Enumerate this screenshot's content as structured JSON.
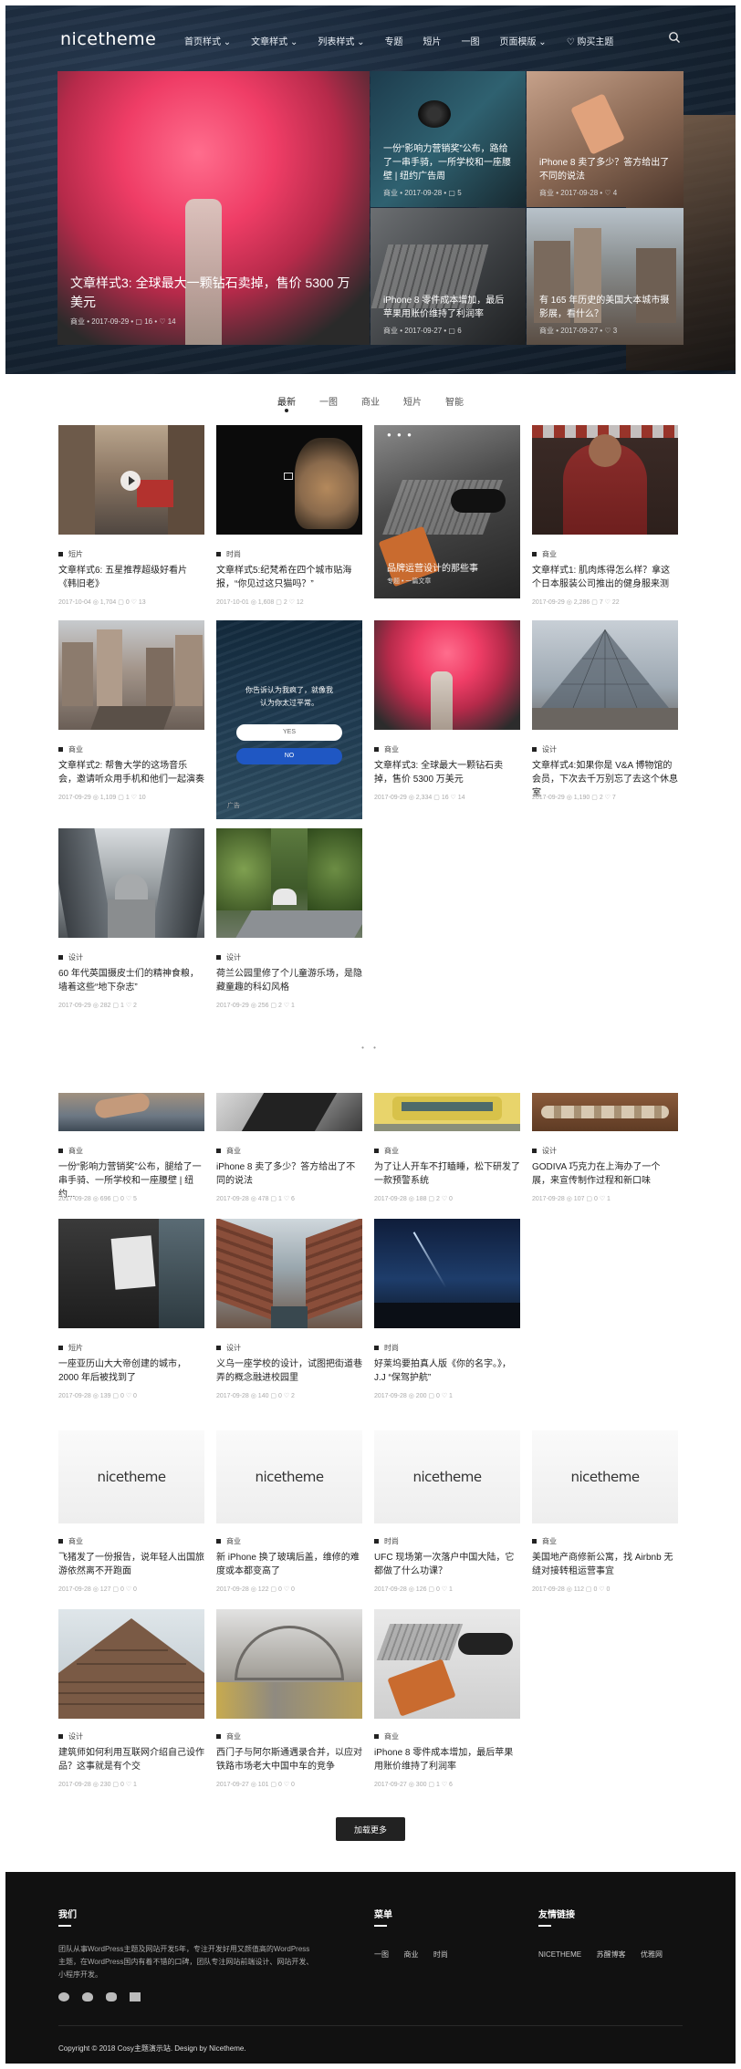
{
  "header": {
    "logo": "nicetheme",
    "menu": [
      "首页样式 ⌄",
      "文章样式 ⌄",
      "列表样式 ⌄",
      "专题",
      "短片",
      "一图",
      "页面模版 ⌄",
      "♡ 购买主题"
    ]
  },
  "featured": {
    "big": {
      "title": "文章样式3: 全球最大一颗钻石卖掉，售价 5300 万美元",
      "meta": "商业 • 2017-09-29 • ▢ 16 • ♡ 14"
    },
    "small": [
      {
        "title": "一份“影响力营销奖”公布，路给了一串手骑，一所学校和一座腰壁 | 纽约广告周",
        "meta": "商业 • 2017-09-28 • ▢ 5"
      },
      {
        "title": "iPhone 8 卖了多少？答方给出了不同的说法",
        "meta": "商业 • 2017-09-28 • ♡ 4"
      },
      {
        "title": "iPhone 8 零件成本增加，最后苹果用账价维持了利润率",
        "meta": "商业 • 2017-09-27 • ▢ 6"
      },
      {
        "title": "有 165 年历史的美国大本城市摄影展，看什么？",
        "meta": "商业 • 2017-09-27 • ♡ 3"
      }
    ]
  },
  "tabs": [
    "最新",
    "一图",
    "商业",
    "短片",
    "智能"
  ],
  "grid1": [
    {
      "cat": "短片",
      "title": "文章样式6: 五星推荐超级好看片《韩旧老》",
      "meta": "2017-10-04  ◎ 1,704  ▢ 0  ♡ 13"
    },
    {
      "cat": "时尚",
      "title": "文章样式5:纪梵希在四个城市贴海报，“你见过这只猫吗？”",
      "meta": "2017-10-01  ◎ 1,608  ▢ 2  ♡ 12"
    },
    {
      "cat": "专题",
      "title": "品牌运营设计的那些事",
      "meta": "专题 • 一篇文章"
    },
    {
      "cat": "商业",
      "title": "文章样式1: 肌肉炼得怎么样？拿这个日本服装公司推出的健身服来测",
      "meta": "2017-09-29  ◎ 2,286  ▢ 7  ♡ 22"
    },
    {
      "cat": "商业",
      "title": "文章样式2: 帮鲁大学的这场音乐会，邀请听众用手机和他们一起演奏",
      "meta": "2017-09-29  ◎ 1,109  ▢ 1  ♡ 10"
    },
    {
      "cat": "广告",
      "title": "你告诉认为我疯了，就像我认为你太过平常。",
      "yes": "YES",
      "no": "NO"
    },
    {
      "cat": "商业",
      "title": "文章样式3: 全球最大一颗钻石卖掉，售价 5300 万美元",
      "meta": "2017-09-29  ◎ 2,334  ▢ 16  ♡ 14"
    },
    {
      "cat": "设计",
      "title": "文章样式4:如果你是 V&A 博物馆的会员，下次去千万别忘了去这个休息室",
      "meta": "2017-09-29  ◎ 1,190  ▢ 2  ♡ 7"
    },
    {
      "cat": "设计",
      "title": "60 年代英国摄皮士们的精神食粮，墙着这些“地下杂志”",
      "meta": "2017-09-29  ◎ 282  ▢ 1  ♡ 2"
    },
    {
      "cat": "设计",
      "title": "荷兰公园里修了个儿童游乐场，是隐藏童趣的科幻风格",
      "meta": "2017-09-29  ◎ 256  ▢ 2  ♡ 1"
    }
  ],
  "grid2": [
    {
      "cat": "商业",
      "title": "一份“影响力营销奖”公布，腿给了一串手骑、一所学校和一座腰壁 | 纽约...",
      "meta": "2017-09-28  ◎ 696  ▢ 0  ♡ 5"
    },
    {
      "cat": "商业",
      "title": "iPhone 8 卖了多少？答方给出了不同的说法",
      "meta": "2017-09-28  ◎ 478  ▢ 1  ♡ 6"
    },
    {
      "cat": "商业",
      "title": "为了让人开车不打瞌睡，松下研发了一款预警系统",
      "meta": "2017-09-28  ◎ 188  ▢ 2  ♡ 0"
    },
    {
      "cat": "设计",
      "title": "GODIVA 巧克力在上海办了一个展，来宣传制作过程和新口味",
      "meta": "2017-09-28  ◎ 107  ▢ 0  ♡ 1"
    },
    {
      "cat": "短片",
      "title": "一座亚历山大大帝创建的城市，2000 年后被找到了",
      "meta": "2017-09-28  ◎ 139  ▢ 0  ♡ 0"
    },
    {
      "cat": "设计",
      "title": "义乌一座学校的设计，试图把街道巷弄的概念融进校园里",
      "meta": "2017-09-28  ◎ 140  ▢ 0  ♡ 2"
    },
    {
      "cat": "时尚",
      "title": "好莱坞要拍真人版《你的名字。》，J.J “保驾护航”",
      "meta": "2017-09-28  ◎ 200  ▢ 0  ♡ 1"
    },
    {
      "cat": "商业",
      "title": "飞猪发了一份报告，说年轻人出国旅游依然离不开跑面",
      "meta": "2017-09-28  ◎ 127  ▢ 0  ♡ 0"
    },
    {
      "cat": "商业",
      "title": "新 iPhone 换了玻璃后盖，维修的难度或本都变高了",
      "meta": "2017-09-28  ◎ 122  ▢ 0  ♡ 0"
    },
    {
      "cat": "时尚",
      "title": "UFC 现场第一次落户中国大陆，它都做了什么功课？",
      "meta": "2017-09-28  ◎ 126  ▢ 0  ♡ 1"
    },
    {
      "cat": "商业",
      "title": "美国地产商修新公寓，找 Airbnb 无缝对接转租运营事宜",
      "meta": "2017-09-28  ◎ 112  ▢ 0  ♡ 0"
    },
    {
      "cat": "设计",
      "title": "建筑师如何利用互联网介绍自己设作品？这事就是有个交",
      "meta": "2017-09-28  ◎ 230  ▢ 0  ♡ 1"
    },
    {
      "cat": "商业",
      "title": "西门子与阿尔斯通遇录合并，以应对铁路市场老大中国中车的竞争",
      "meta": "2017-09-27  ◎ 101  ▢ 0  ♡ 0"
    },
    {
      "cat": "商业",
      "title": "iPhone 8 零件成本增加，最后苹果用账价维持了利润率",
      "meta": "2017-09-27  ◎ 300  ▢ 1  ♡ 6"
    }
  ],
  "placeholder_logo": "nicetheme",
  "load_more": "加载更多",
  "footer": {
    "about_heading": "我们",
    "about_text": "团队从事WordPress主题及网站开发5年，专注开发好用又颜值高的WordPress主题，在WordPress国内有着不错的口碑，团队专注网站前端设计、网站开发、小程序开发。",
    "menu_heading": "菜单",
    "menu_links": [
      "一图",
      "商业",
      "时尚"
    ],
    "friends_heading": "友情链接",
    "friend_links": [
      "NICETHEME",
      "苏醒博客",
      "优雅网"
    ],
    "copyright": "Copyright © 2018 Cosy主题演示站. Design by Nicetheme."
  },
  "colors": {
    "accent_blue": "#1f57c3",
    "dark": "#222222",
    "footer_bg": "#111111"
  }
}
